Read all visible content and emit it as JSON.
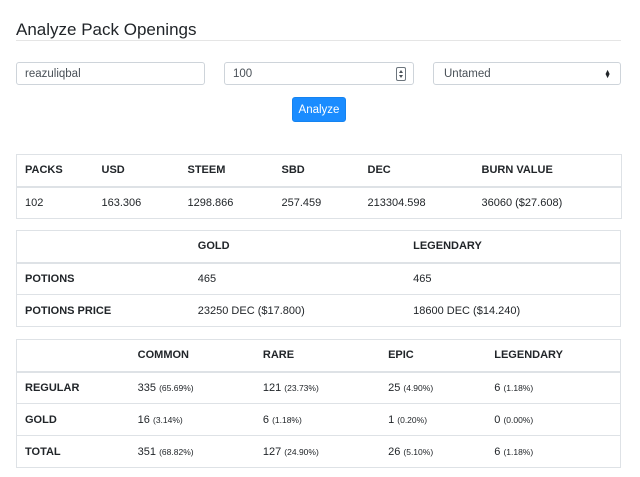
{
  "page": {
    "title": "Analyze Pack Openings"
  },
  "form": {
    "username": "reazuliqbal",
    "pack_count": "100",
    "edition": "Untamed",
    "analyze_label": "Analyze"
  },
  "summary": {
    "headers": [
      "PACKS",
      "USD",
      "STEEM",
      "SBD",
      "DEC",
      "BURN VALUE"
    ],
    "row": [
      "102",
      "163.306",
      "1298.866",
      "257.459",
      "213304.598",
      "36060 ($27.608)"
    ]
  },
  "potions": {
    "headers": [
      "",
      "GOLD",
      "LEGENDARY"
    ],
    "rows": [
      [
        "POTIONS",
        "465",
        "465"
      ],
      [
        "POTIONS PRICE",
        "23250 DEC ($17.800)",
        "18600 DEC ($14.240)"
      ]
    ]
  },
  "rarity": {
    "headers": [
      "",
      "COMMON",
      "RARE",
      "EPIC",
      "LEGENDARY"
    ],
    "rows": [
      {
        "label": "REGULAR",
        "cells": [
          {
            "n": "335",
            "p": "(65.69%)"
          },
          {
            "n": "121",
            "p": "(23.73%)"
          },
          {
            "n": "25",
            "p": "(4.90%)"
          },
          {
            "n": "6",
            "p": "(1.18%)"
          }
        ]
      },
      {
        "label": "GOLD",
        "cells": [
          {
            "n": "16",
            "p": "(3.14%)"
          },
          {
            "n": "6",
            "p": "(1.18%)"
          },
          {
            "n": "1",
            "p": "(0.20%)"
          },
          {
            "n": "0",
            "p": "(0.00%)"
          }
        ]
      },
      {
        "label": "TOTAL",
        "cells": [
          {
            "n": "351",
            "p": "(68.82%)"
          },
          {
            "n": "127",
            "p": "(24.90%)"
          },
          {
            "n": "26",
            "p": "(5.10%)"
          },
          {
            "n": "6",
            "p": "(1.18%)"
          }
        ]
      }
    ]
  }
}
